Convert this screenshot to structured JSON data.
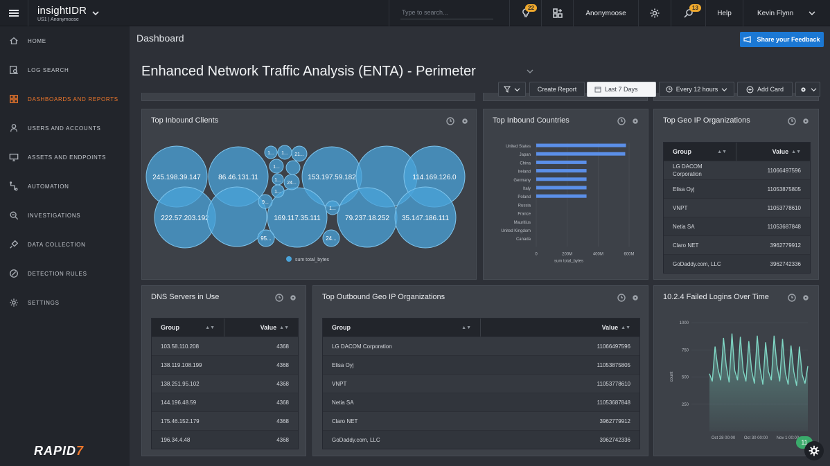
{
  "topbar": {
    "brand": "insightIDR",
    "brand_sub": "US1 | Anonymoose",
    "search_placeholder": "Type to search...",
    "notif_count_1": "22",
    "org": "Anonymoose",
    "notif_count_2": "13",
    "help": "Help",
    "user": "Kevin Flynn"
  },
  "sidebar": {
    "items": [
      {
        "label": "HOME",
        "icon": "home-icon"
      },
      {
        "label": "LOG SEARCH",
        "icon": "log-search-icon"
      },
      {
        "label": "DASHBOARDS AND REPORTS",
        "icon": "dashboard-icon"
      },
      {
        "label": "USERS AND ACCOUNTS",
        "icon": "user-icon"
      },
      {
        "label": "ASSETS AND ENDPOINTS",
        "icon": "monitor-icon"
      },
      {
        "label": "AUTOMATION",
        "icon": "automation-icon"
      },
      {
        "label": "INVESTIGATIONS",
        "icon": "investigations-icon"
      },
      {
        "label": "DATA COLLECTION",
        "icon": "plug-icon"
      },
      {
        "label": "DETECTION RULES",
        "icon": "detection-icon"
      },
      {
        "label": "SETTINGS",
        "icon": "gear-icon"
      }
    ],
    "active": "DASHBOARDS AND REPORTS",
    "logo_main": "RAPID",
    "logo_accent": "7"
  },
  "header": {
    "breadcrumb": "Dashboard",
    "feedback": "Share your Feedback",
    "title": "Enhanced Network Traffic Analysis (ENTA) - Perimeter",
    "create_report": "Create Report",
    "date_range": "Last 7 Days",
    "refresh": "Every 12 hours",
    "add_card": "Add Card"
  },
  "cards": {
    "inbound_clients": {
      "title": "Top Inbound Clients",
      "legend": "sum total_bytes",
      "bubbles": [
        "245.198.39.147",
        "86.46.131.11",
        "153.197.59.182",
        "114.169.126.0",
        "222.57.203.192",
        "169.117.35.111",
        "79.237.18.252",
        "35.147.186.111",
        "1...",
        "1...",
        "21...",
        "1...",
        "1...",
        "1...",
        "24...",
        "9...",
        "1...",
        "95...",
        "24..."
      ]
    },
    "inbound_countries": {
      "title": "Top Inbound Countries"
    },
    "geo_orgs": {
      "title": "Top Geo IP Organizations",
      "col_group": "Group",
      "col_value": "Value",
      "rows": [
        {
          "group": "LG DACOM Corporation",
          "value": "11066497596"
        },
        {
          "group": "Elisa Oyj",
          "value": "11053875805"
        },
        {
          "group": "VNPT",
          "value": "11053778610"
        },
        {
          "group": "Netia SA",
          "value": "11053687848"
        },
        {
          "group": "Claro NET",
          "value": "3962779912"
        },
        {
          "group": "GoDaddy.com, LLC",
          "value": "3962742336"
        }
      ]
    },
    "dns": {
      "title": "DNS Servers in Use",
      "col_group": "Group",
      "col_value": "Value",
      "rows": [
        {
          "group": "103.58.110.208",
          "value": "4368"
        },
        {
          "group": "138.119.108.199",
          "value": "4368"
        },
        {
          "group": "138.251.95.102",
          "value": "4368"
        },
        {
          "group": "144.196.48.59",
          "value": "4368"
        },
        {
          "group": "175.46.152.179",
          "value": "4368"
        },
        {
          "group": "196.34.4.48",
          "value": "4368"
        }
      ]
    },
    "outbound_orgs": {
      "title": "Top Outbound Geo IP Organizations",
      "col_group": "Group",
      "col_value": "Value",
      "rows": [
        {
          "group": "LG DACOM Corporation",
          "value": "11066497596"
        },
        {
          "group": "Elisa Oyj",
          "value": "11053875805"
        },
        {
          "group": "VNPT",
          "value": "11053778610"
        },
        {
          "group": "Netia SA",
          "value": "11053687848"
        },
        {
          "group": "Claro NET",
          "value": "3962779912"
        },
        {
          "group": "GoDaddy.com, LLC",
          "value": "3962742336"
        }
      ]
    },
    "failed_logins": {
      "title": "10.2.4 Failed Logins Over Time"
    }
  },
  "chart_badge": "11",
  "chart_data": [
    {
      "type": "bar",
      "orientation": "horizontal",
      "title": "Top Inbound Countries",
      "categories": [
        "United States",
        "Japan",
        "China",
        "Ireland",
        "Germany",
        "Italy",
        "Poland",
        "Russia",
        "France",
        "Mauritius",
        "United Kingdom",
        "Canada"
      ],
      "values": [
        580000000,
        575000000,
        325000000,
        325000000,
        325000000,
        325000000,
        325000000,
        0,
        0,
        0,
        0,
        0
      ],
      "xlabel": "sum total_bytes",
      "ticks": [
        "0",
        "200M",
        "400M",
        "600M"
      ],
      "xlim": [
        0,
        600000000
      ],
      "color": "#5b8fe8"
    },
    {
      "type": "area",
      "title": "10.2.4 Failed Logins Over Time",
      "ylabel": "count",
      "yticks": [
        "1000",
        "750",
        "500",
        "250"
      ],
      "ylim": [
        0,
        1000
      ],
      "xticks": [
        "Oct 28 00:00",
        "Oct 30 00:00",
        "Nov 1 00:00"
      ],
      "values": [
        530,
        460,
        780,
        580,
        470,
        860,
        600,
        450,
        900,
        560,
        470,
        870,
        560,
        460,
        830,
        560,
        440,
        880,
        580,
        430,
        820,
        550,
        470,
        880,
        610,
        460,
        850,
        540,
        430,
        790,
        550,
        420,
        780,
        520,
        440,
        600
      ],
      "color": "#7fd6c4"
    }
  ]
}
